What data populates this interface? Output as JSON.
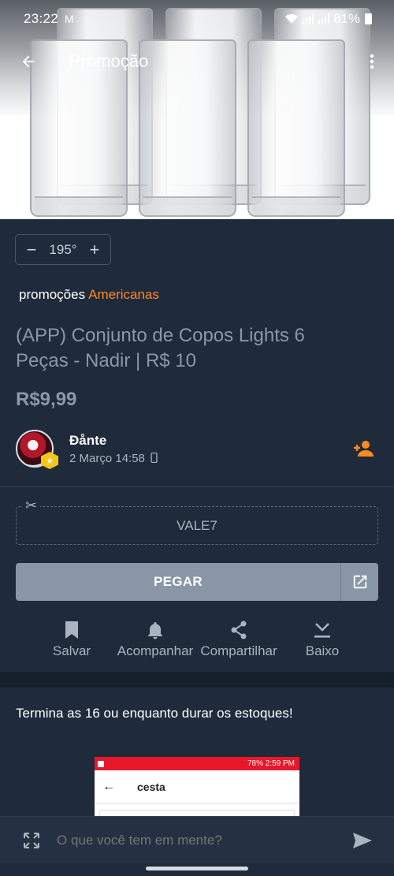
{
  "status_bar": {
    "time": "23:22",
    "mail_icon": "M",
    "battery": "81%"
  },
  "app_bar": {
    "title": "Promoção"
  },
  "deal": {
    "temperature": "195°",
    "store_prefix": "promoções",
    "store_name": "Americanas",
    "title": "(APP) Conjunto de Copos Lights 6 Peças - Nadir | R$ 10",
    "price": "R$9,99",
    "coupon": "VALE7",
    "get_button": "PEGAR"
  },
  "author": {
    "name": "Đånte",
    "date": "2 Março 14:58"
  },
  "actions": [
    {
      "icon": "bookmark-icon",
      "label": "Salvar"
    },
    {
      "icon": "bell-icon",
      "label": "Acompanhar"
    },
    {
      "icon": "share-icon",
      "label": "Compartilhar"
    },
    {
      "icon": "download-icon",
      "label": "Baixo"
    }
  ],
  "description": "Termina as 16 ou enquanto durar os estoques!",
  "embedded_screenshot": {
    "status": "78% 2:59 PM",
    "title": "cesta"
  },
  "composer": {
    "placeholder": "O que você tem em mente?"
  },
  "colors": {
    "background": "#1f2a3a",
    "accent": "#ff8a1f",
    "button": "#8896a6"
  }
}
